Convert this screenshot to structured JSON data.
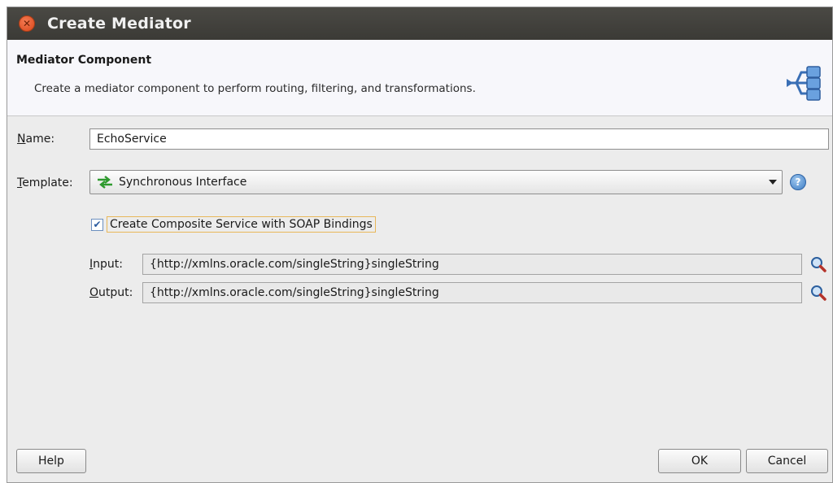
{
  "window": {
    "title": "Create Mediator",
    "close_icon": "close-icon"
  },
  "header": {
    "title": "Mediator Component",
    "description": "Create a mediator component to perform routing, filtering, and transformations.",
    "icon": "mediator-routing-icon"
  },
  "form": {
    "name": {
      "label_mnemonic": "N",
      "label_rest": "ame:",
      "value": "EchoService"
    },
    "template": {
      "label_mnemonic": "T",
      "label_rest": "emplate:",
      "selected": "Synchronous Interface",
      "icon": "synchronous-interface-icon"
    },
    "composite": {
      "checked": true,
      "label": "Create Composite Service with SOAP Bindings"
    },
    "input": {
      "label_mnemonic": "I",
      "label_rest": "nput:",
      "value": "{http://xmlns.oracle.com/singleString}singleString"
    },
    "output": {
      "label_mnemonic": "O",
      "label_rest": "utput:",
      "value": "{http://xmlns.oracle.com/singleString}singleString"
    }
  },
  "buttons": {
    "help": "Help",
    "ok": "OK",
    "cancel": "Cancel"
  },
  "colors": {
    "titlebar": "#3b3a36",
    "close_button": "#d9471b",
    "body_background": "#ececec",
    "focus_border": "#e8b75a"
  }
}
